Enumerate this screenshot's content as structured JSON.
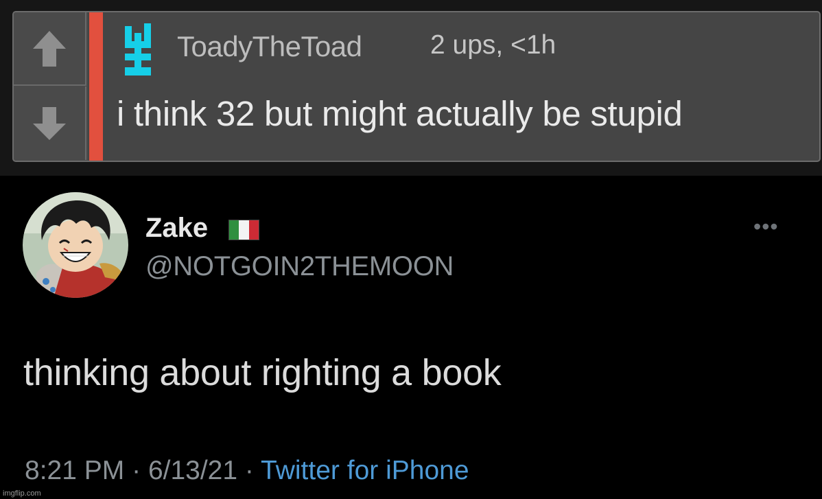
{
  "comment": {
    "author": "ToadyTheToad",
    "meta": "2 ups, <1h",
    "text": "i think 32 but might actually be stupid",
    "accent_color": "#e2503e",
    "avatar_color": "#16cfe8",
    "upvote_icon": "up-arrow-icon",
    "downvote_icon": "down-arrow-icon"
  },
  "tweet": {
    "display_name": "Zake",
    "flag_icon": "italy-flag-icon",
    "handle": "@NOTGOIN2THEMOON",
    "more_icon": "more-options-icon",
    "text": "thinking about righting a book",
    "time": "8:21 PM",
    "separator": "·",
    "date": "6/13/21",
    "source": "Twitter for iPhone",
    "source_color": "#4e9ad6"
  },
  "watermark": "imgflip.com"
}
